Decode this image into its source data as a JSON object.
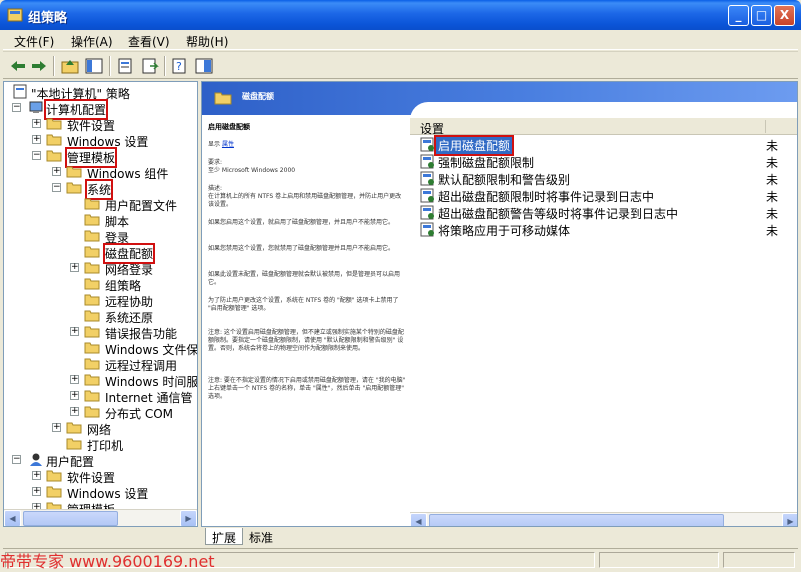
{
  "window": {
    "title": "组策略",
    "btn_min": "_",
    "btn_max": "□",
    "btn_close": "X"
  },
  "menu": [
    "文件(F)",
    "操作(A)",
    "查看(V)",
    "帮助(H)"
  ],
  "tree": {
    "root": "\"本地计算机\" 策略",
    "computer_config": "计算机配置",
    "software_settings": "软件设置",
    "windows_settings": "Windows 设置",
    "admin_templates": "管理模板",
    "windows_components": "Windows 组件",
    "system": "系统",
    "user_profiles": "用户配置文件",
    "scripts": "脚本",
    "logon": "登录",
    "disk_quotas": "磁盘配额",
    "net_logon": "网络登录",
    "group_policy": "组策略",
    "remote_assistance": "远程协助",
    "system_restore": "系统还原",
    "error_reporting": "错误报告功能",
    "windows_file_protection": "Windows 文件保护",
    "rpc": "远程过程调用",
    "windows_time": "Windows 时间服务",
    "internet_comm": "Internet 通信管",
    "dcom": "分布式 COM",
    "network": "网络",
    "printers": "打印机",
    "user_config": "用户配置",
    "u_software_settings": "软件设置",
    "u_windows_settings": "Windows 设置",
    "u_admin_templates": "管理模板"
  },
  "right": {
    "header_title": "磁盘配额",
    "desc_heading": "启用磁盘配额",
    "desc_show_label": "显示",
    "desc_show_link": "属性",
    "desc_req_label": "要求:",
    "desc_req_text": "至少 Microsoft Windows 2000",
    "desc_label": "描述:",
    "desc_p1": "在计算机上的所有 NTFS 卷上启用和禁用磁盘配额管理，并防止用户更改该设置。",
    "desc_p2": "如果您启用这个设置，就启用了磁盘配额管理，并且用户不能禁用它。",
    "desc_p3": "如果您禁用这个设置，您就禁用了磁盘配额管理并且用户不能启用它。",
    "desc_p4": "如果此设置未配置，磁盘配额管理就会默认被禁用，但是管理员可以启用它。",
    "desc_p5": "为了防止用户更改这个设置，系统在 NTFS 卷的 \"配额\" 选项卡上禁用了 \"启用配额管理\" 选项。",
    "desc_p6": "注意: 这个设置启用磁盘配额管理，但不建立或强制实施某个特别的磁盘配额限制。要指定一个磁盘配额限制，请使用 \"默认配额限制和警告级别\" 设置。否则，系统会将卷上的物理空间作为配额限制来使用。",
    "desc_p7": "注意: 要在不指定设置的情况下启用或禁用磁盘配额管理，请在 \"我的电脑\" 上右键单击一个 NTFS 卷的名称，单击 \"属性\"，然后单击 \"启用配额管理\" 选项。",
    "col_setting": "设置",
    "col_state_stub": "",
    "settings": [
      {
        "label": "启用磁盘配额",
        "state": "未"
      },
      {
        "label": "强制磁盘配额限制",
        "state": "未"
      },
      {
        "label": "默认配额限制和警告级别",
        "state": "未"
      },
      {
        "label": "超出磁盘配额限制时将事件记录到日志中",
        "state": "未"
      },
      {
        "label": "超出磁盘配额警告等级时将事件记录到日志中",
        "state": "未"
      },
      {
        "label": "将策略应用于可移动媒体",
        "state": "未"
      }
    ]
  },
  "tabs": [
    "扩展",
    "标准"
  ],
  "watermark": "帝带专家 www.9600169.net",
  "colors": {
    "accent": "#316ac5",
    "highlight_box": "#d01010"
  }
}
